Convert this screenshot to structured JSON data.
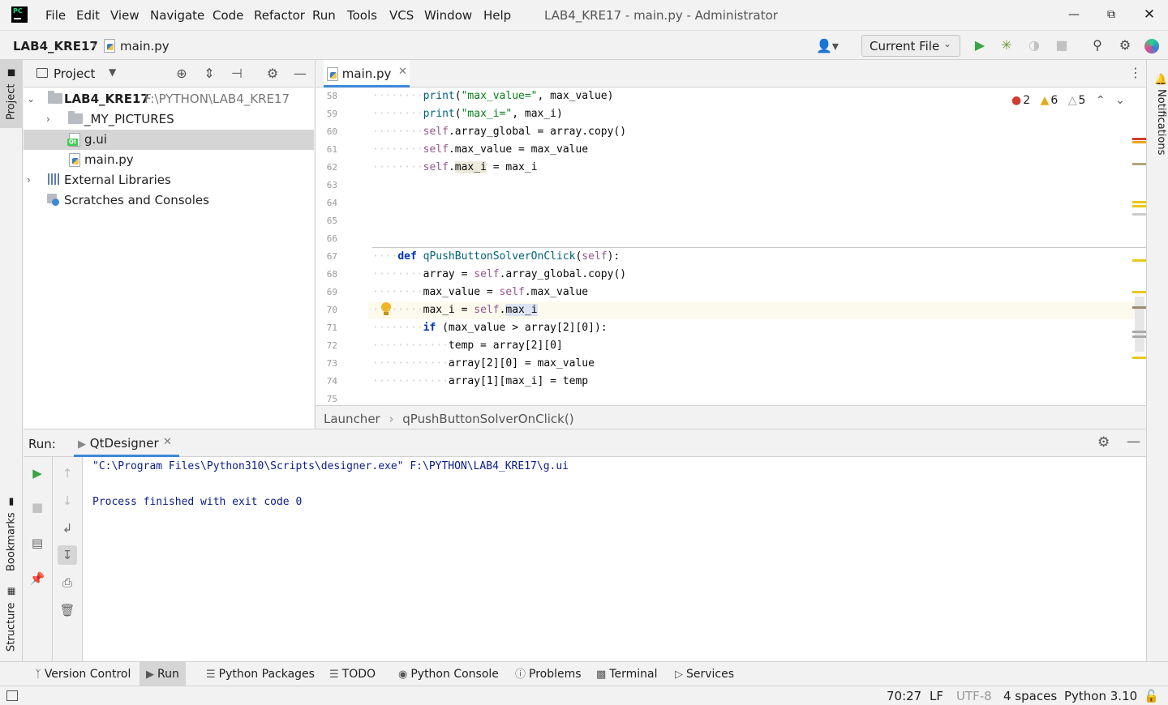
{
  "titlebar": {
    "menu": [
      "File",
      "Edit",
      "View",
      "Navigate",
      "Code",
      "Refactor",
      "Run",
      "Tools",
      "VCS",
      "Window",
      "Help"
    ],
    "window_title": "LAB4_KRE17 - main.py - Administrator"
  },
  "navbar": {
    "project": "LAB4_KRE17",
    "file": "main.py",
    "run_config": "Current File"
  },
  "sidebar_left": {
    "project_tab": "Project",
    "bookmarks_tab": "Bookmarks",
    "structure_tab": "Structure"
  },
  "sidebar_right": {
    "notifications_tab": "Notifications"
  },
  "project_panel": {
    "title": "Project",
    "tree": [
      {
        "label": "LAB4_KRE17",
        "path": "F:\\PYTHON\\LAB4_KRE17"
      },
      {
        "label": "_MY_PICTURES"
      },
      {
        "label": "g.ui"
      },
      {
        "label": "main.py"
      },
      {
        "label": "External Libraries"
      },
      {
        "label": "Scratches and Consoles"
      }
    ]
  },
  "editor": {
    "tab": "main.py",
    "inspections": {
      "errors": "2",
      "warnings": "6",
      "weak": "5"
    },
    "line_numbers": [
      "58",
      "59",
      "60",
      "61",
      "62",
      "63",
      "64",
      "65",
      "66",
      "67",
      "68",
      "69",
      "70",
      "71",
      "72",
      "73",
      "74",
      "75"
    ],
    "breadcrumb": [
      "Launcher",
      "qPushButtonSolverOnClick()"
    ]
  },
  "run_panel": {
    "label": "Run:",
    "tab": "QtDesigner",
    "console": [
      "\"C:\\Program Files\\Python310\\Scripts\\designer.exe\" F:\\PYTHON\\LAB4_KRE17\\g.ui",
      "",
      "Process finished with exit code 0"
    ]
  },
  "bottom_tabs": [
    "Version Control",
    "Run",
    "Python Packages",
    "TODO",
    "Python Console",
    "Problems",
    "Terminal",
    "Services"
  ],
  "statusbar": {
    "position": "70:27",
    "line_sep": "LF",
    "encoding": "UTF-8",
    "indent": "4 spaces",
    "interpreter": "Python 3.10"
  },
  "colors": {
    "accent": "#3c88d8",
    "keyword": "#0033b3",
    "string": "#067d17",
    "self": "#94558d",
    "error": "#d43a2f",
    "warning": "#e8a81a",
    "run_green": "#3aa447"
  }
}
